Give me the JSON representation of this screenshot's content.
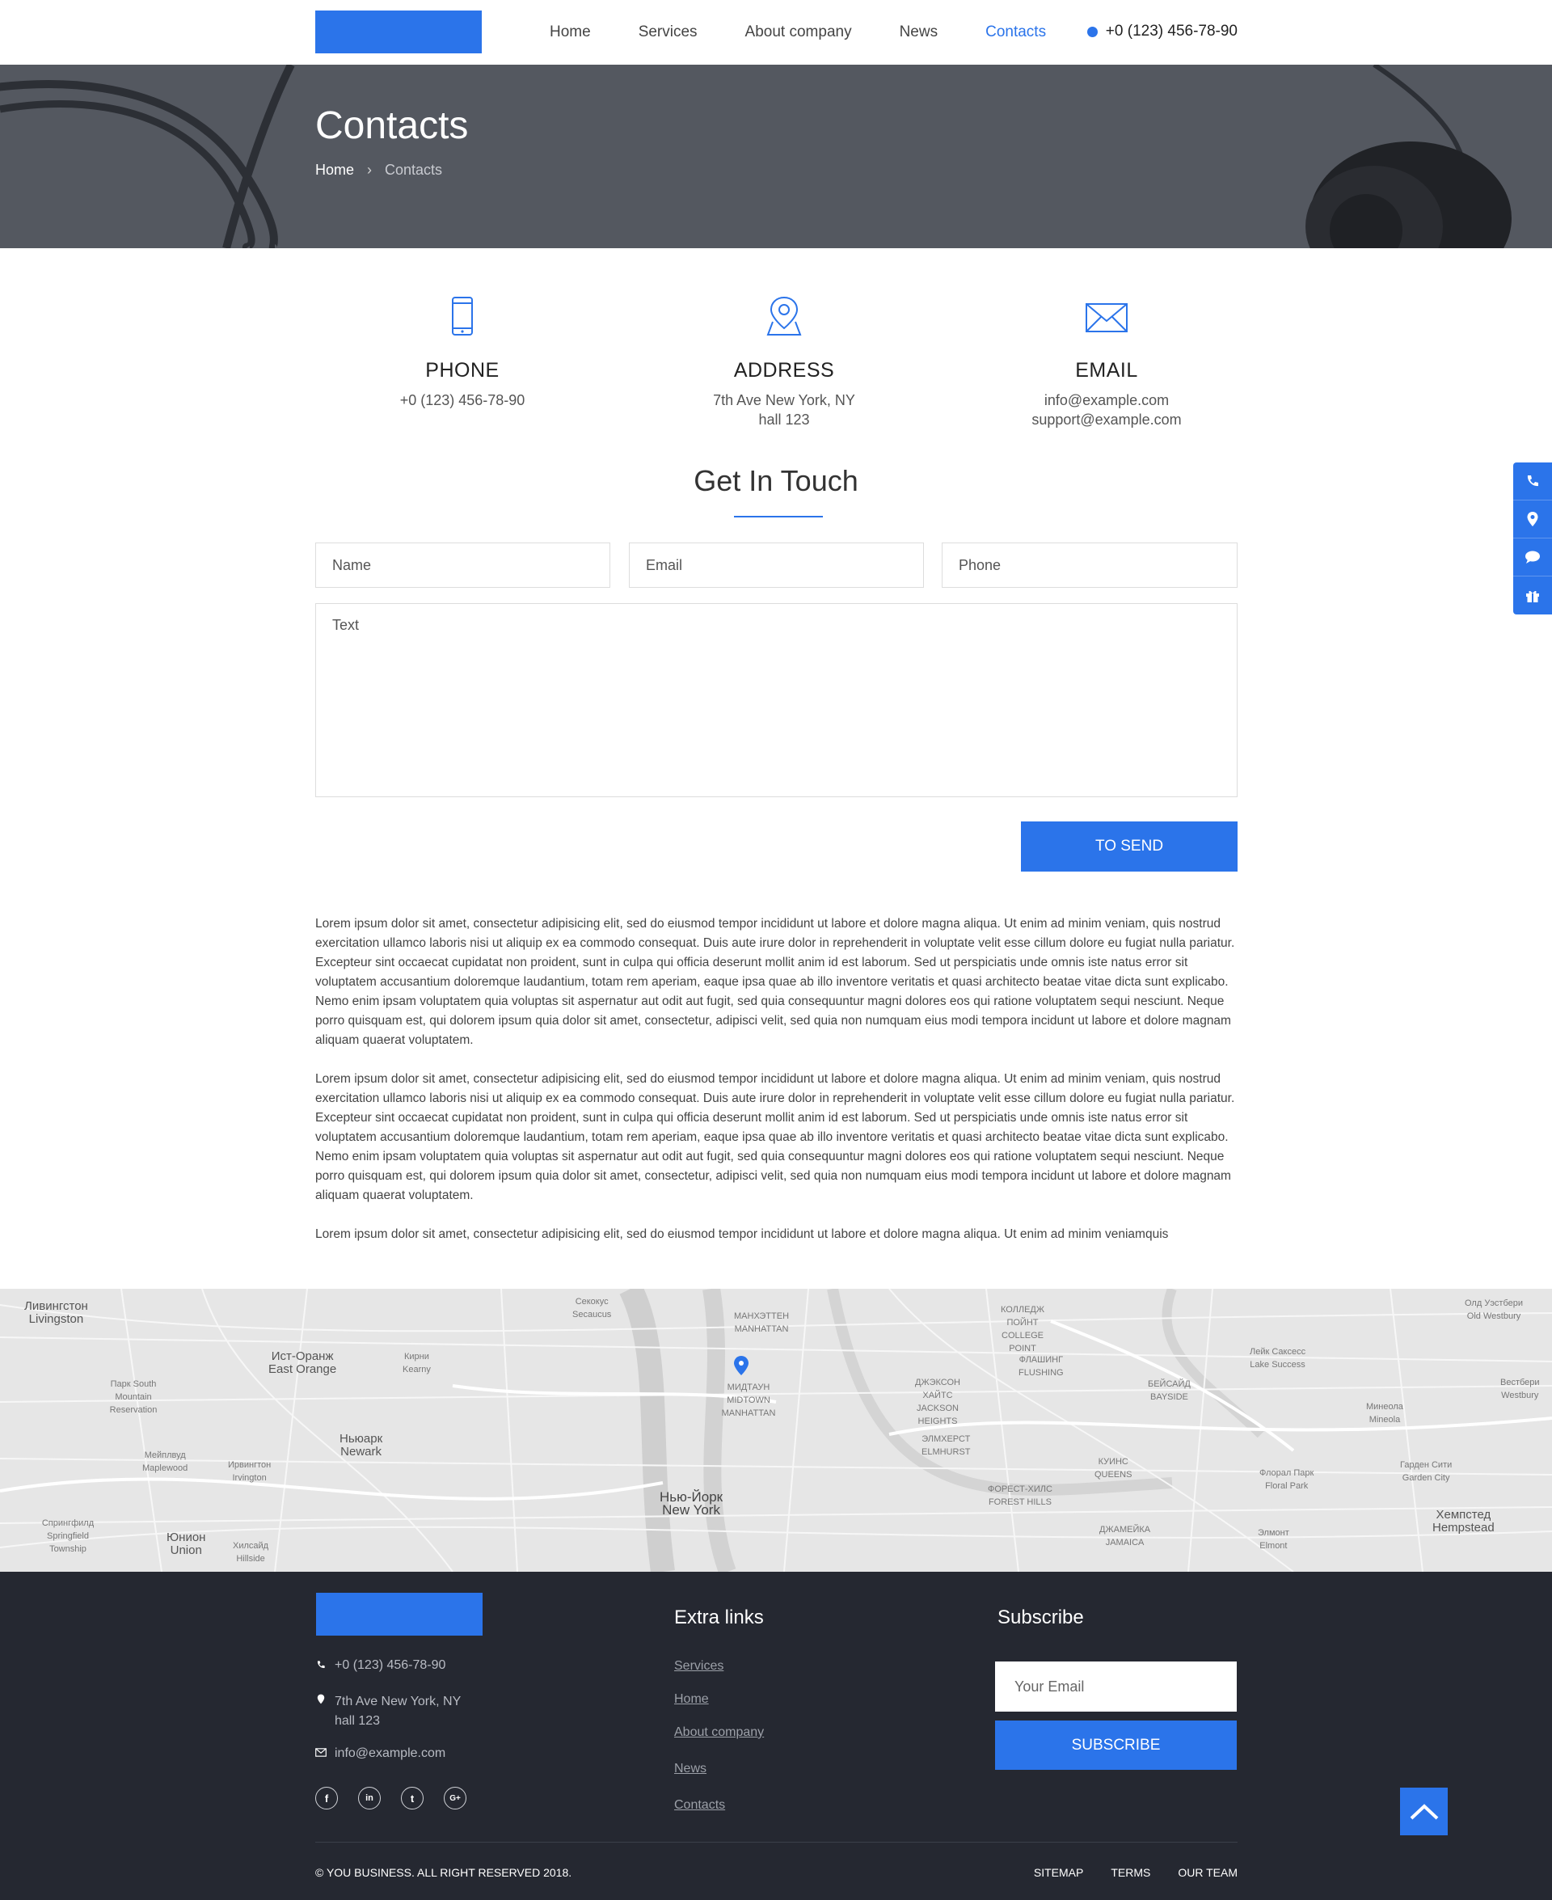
{
  "header": {
    "nav": [
      "Home",
      "Services",
      "About company",
      "News",
      "Contacts"
    ],
    "active_index": 4,
    "phone": "+0 (123) 456-78-90"
  },
  "hero": {
    "title": "Contacts",
    "breadcrumb_home": "Home",
    "breadcrumb_separator": "›",
    "breadcrumb_current": "Contacts"
  },
  "info": {
    "phone": {
      "title": "PHONE",
      "line1": "+0 (123) 456-78-90",
      "icon": "phone-icon"
    },
    "address": {
      "title": "ADDRESS",
      "line1": "7th Ave New York, NY",
      "line2": "hall 123",
      "icon": "map-pin-icon"
    },
    "email": {
      "title": "EMAIL",
      "line1": "info@example.com",
      "line2": "support@example.com",
      "icon": "envelope-icon"
    }
  },
  "form": {
    "heading": "Get In Touch",
    "name_placeholder": "Name",
    "email_placeholder": "Email",
    "phone_placeholder": "Phone",
    "text_placeholder": "Text",
    "submit_label": "TO SEND"
  },
  "body": {
    "paragraph1": "Lorem ipsum dolor sit amet, consectetur adipisicing elit, sed do eiusmod tempor incididunt ut labore et dolore magna aliqua. Ut enim ad minim veniam, quis nostrud exercitation ullamco laboris nisi ut aliquip ex ea commodo consequat. Duis aute irure dolor in reprehenderit in voluptate velit esse cillum dolore eu fugiat nulla pariatur. Excepteur sint occaecat cupidatat non proident, sunt in culpa qui officia deserunt mollit anim id est laborum. Sed ut perspiciatis unde omnis iste natus error sit voluptatem accusantium doloremque laudantium, totam rem aperiam, eaque ipsa quae ab illo inventore veritatis et quasi architecto beatae vitae dicta sunt explicabo. Nemo enim ipsam voluptatem quia voluptas sit aspernatur aut odit aut fugit, sed quia consequuntur magni dolores eos qui ratione voluptatem sequi nesciunt. Neque porro quisquam est, qui dolorem ipsum quia dolor sit amet, consectetur, adipisci velit, sed quia non numquam eius modi tempora incidunt ut labore et dolore magnam aliquam quaerat voluptatem.",
    "paragraph2": "Lorem ipsum dolor sit amet, consectetur adipisicing elit, sed do eiusmod tempor incididunt ut labore et dolore magna aliqua. Ut enim ad minim veniam, quis nostrud exercitation ullamco laboris nisi ut aliquip ex ea commodo consequat. Duis aute irure dolor in reprehenderit in voluptate velit esse cillum dolore eu fugiat nulla pariatur. Excepteur sint occaecat cupidatat non proident, sunt in culpa qui officia deserunt mollit anim id est laborum. Sed ut perspiciatis unde omnis iste natus error sit voluptatem accusantium doloremque laudantium, totam rem aperiam, eaque ipsa quae ab illo inventore veritatis et quasi architecto beatae vitae dicta sunt explicabo. Nemo enim ipsam voluptatem quia voluptas sit aspernatur aut odit aut fugit, sed quia consequuntur magni dolores eos qui ratione voluptatem sequi nesciunt. Neque porro quisquam est, qui dolorem ipsum quia dolor sit amet, consectetur, adipisci velit, sed quia non numquam eius modi tempora incidunt ut labore et dolore magnam aliquam quaerat voluptatem.",
    "paragraph3": "Lorem ipsum dolor sit amet, consectetur adipisicing elit, sed do eiusmod tempor incididunt ut labore et dolore magna aliqua. Ut enim ad minim veniamquis"
  },
  "side_toolbar": [
    "phone-icon",
    "map-pin-icon",
    "chat-bubble-icon",
    "gift-icon"
  ],
  "map": {
    "labels": [
      {
        "text": "Ливингстон",
        "text2": "Livingston"
      },
      {
        "text": "Ист-Оранж",
        "text2": "East Orange"
      },
      {
        "text": "Кирни",
        "text2": "Kearny"
      },
      {
        "text": "Секокус",
        "text2": "Secaucus"
      },
      {
        "text": "МАНХЭТТЕН",
        "text2": "MANHATTAN"
      },
      {
        "text": "Парк South Mountain",
        "text2": "Reservation"
      },
      {
        "text": "Ньюарк",
        "text2": "Newark"
      },
      {
        "text": "Мейплвуд",
        "text2": "Maplewood"
      },
      {
        "text": "Ирвингтон",
        "text2": "Irvington"
      },
      {
        "text": "Спрингфилд",
        "text2": "Springfield Township"
      },
      {
        "text": "Юнион",
        "text2": "Union"
      },
      {
        "text": "Хилсайд",
        "text2": "Hillside"
      },
      {
        "text": "Нью-Йорк",
        "text2": "New York"
      },
      {
        "text": "МИДТАУН",
        "text2": "MIDTOWN MANHATTAN"
      },
      {
        "text": "ДЖЭКСОН ХАЙТС",
        "text2": "JACKSON HEIGHTS"
      },
      {
        "text": "ЭЛМХЕРСТ",
        "text2": "ELMHURST"
      },
      {
        "text": "ФОРЕСТ-ХИЛС",
        "text2": "FOREST HILLS"
      },
      {
        "text": "КУИНС",
        "text2": "QUEENS"
      },
      {
        "text": "ДЖАМЕЙКА",
        "text2": "JAMAICA"
      },
      {
        "text": "КОЛЛЕДЖ ПОЙНТ",
        "text2": "COLLEGE POINT"
      },
      {
        "text": "ФЛАШИНГ",
        "text2": "FLUSHING"
      },
      {
        "text": "БЕЙСАЙД",
        "text2": "BAYSIDE"
      },
      {
        "text": "Лейк Саксесс",
        "text2": "Lake Success"
      },
      {
        "text": "Минеола",
        "text2": "Mineola"
      },
      {
        "text": "Гарден Сити",
        "text2": "Garden City"
      },
      {
        "text": "Флорал Парк",
        "text2": "Floral Park"
      },
      {
        "text": "Элмонт",
        "text2": "Elmont"
      },
      {
        "text": "Хемпстед",
        "text2": "Hempstead"
      },
      {
        "text": "Вестбери",
        "text2": "Westbury"
      },
      {
        "text": "Олд Уэстбери",
        "text2": "Old Westbury"
      }
    ]
  },
  "footer": {
    "phone": "+0 (123) 456-78-90",
    "address1": "7th Ave New York, NY",
    "address2": "hall 123",
    "email": "info@example.com",
    "extra_title": "Extra links",
    "links": [
      "Services",
      "Home",
      "About company",
      "News",
      "Contacts"
    ],
    "subscribe_title": "Subscribe",
    "subscribe_placeholder": "Your Email",
    "subscribe_button": "SUBSCRIBE",
    "social": [
      {
        "icon": "facebook-icon",
        "glyph": "f"
      },
      {
        "icon": "linkedin-icon",
        "glyph": "in"
      },
      {
        "icon": "twitter-icon",
        "glyph": "t"
      },
      {
        "icon": "google-plus-icon",
        "glyph": "G+"
      }
    ],
    "copyright": "© YOU BUSINESS. ALL RIGHT RESERVED 2018.",
    "bottom_links": [
      "SITEMAP",
      "TERMS",
      "OUR TEAM"
    ]
  },
  "colors": {
    "accent": "#2b74ea",
    "hero_bg": "#545860",
    "footer_bg": "#252831"
  }
}
